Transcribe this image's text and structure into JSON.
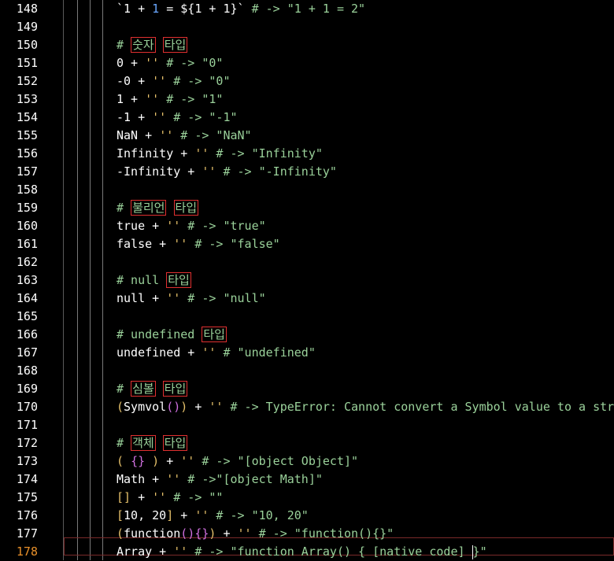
{
  "editor": {
    "line_numbers": [
      "148",
      "149",
      "150",
      "151",
      "152",
      "153",
      "154",
      "155",
      "156",
      "157",
      "158",
      "159",
      "160",
      "161",
      "162",
      "163",
      "164",
      "165",
      "166",
      "167",
      "168",
      "169",
      "170",
      "171",
      "172",
      "173",
      "174",
      "175",
      "176",
      "177",
      "178"
    ],
    "current_line": "178",
    "code_lines": [
      [
        {
          "t": "`1 + ",
          "c": "op"
        },
        {
          "t": "1",
          "c": "num"
        },
        {
          "t": " = ",
          "c": "op"
        },
        {
          "t": "${1 + 1}`",
          "c": "op"
        },
        {
          "t": " # -> \"1 + 1 = 2\"",
          "c": "comment"
        }
      ],
      [],
      [
        {
          "t": "# ",
          "c": "comment"
        },
        {
          "t": "숫자",
          "c": "ko"
        },
        {
          "t": " ",
          "c": "comment"
        },
        {
          "t": "타입",
          "c": "ko"
        }
      ],
      [
        {
          "t": "0 + ",
          "c": "op"
        },
        {
          "t": "''",
          "c": "quote"
        },
        {
          "t": " # -> \"0\"",
          "c": "comment"
        }
      ],
      [
        {
          "t": "-0 + ",
          "c": "op"
        },
        {
          "t": "''",
          "c": "quote"
        },
        {
          "t": " # -> \"0\"",
          "c": "comment"
        }
      ],
      [
        {
          "t": "1 + ",
          "c": "op"
        },
        {
          "t": "''",
          "c": "quote"
        },
        {
          "t": " # -> \"1\"",
          "c": "comment"
        }
      ],
      [
        {
          "t": "-1 + ",
          "c": "op"
        },
        {
          "t": "''",
          "c": "quote"
        },
        {
          "t": " # -> \"-1\"",
          "c": "comment"
        }
      ],
      [
        {
          "t": "NaN + ",
          "c": "op"
        },
        {
          "t": "''",
          "c": "quote"
        },
        {
          "t": " # -> \"NaN\"",
          "c": "comment"
        }
      ],
      [
        {
          "t": "Infinity + ",
          "c": "op"
        },
        {
          "t": "''",
          "c": "quote"
        },
        {
          "t": " # -> \"Infinity\"",
          "c": "comment"
        }
      ],
      [
        {
          "t": "-Infinity + ",
          "c": "op"
        },
        {
          "t": "''",
          "c": "quote"
        },
        {
          "t": " # -> \"-Infinity\"",
          "c": "comment"
        }
      ],
      [],
      [
        {
          "t": "# ",
          "c": "comment"
        },
        {
          "t": "불리언",
          "c": "ko"
        },
        {
          "t": " ",
          "c": "comment"
        },
        {
          "t": "타입",
          "c": "ko"
        }
      ],
      [
        {
          "t": "true + ",
          "c": "op"
        },
        {
          "t": "''",
          "c": "quote"
        },
        {
          "t": " # -> \"true\"",
          "c": "comment"
        }
      ],
      [
        {
          "t": "false + ",
          "c": "op"
        },
        {
          "t": "''",
          "c": "quote"
        },
        {
          "t": " # -> \"false\"",
          "c": "comment"
        }
      ],
      [],
      [
        {
          "t": "# null ",
          "c": "comment"
        },
        {
          "t": "타입",
          "c": "ko"
        }
      ],
      [
        {
          "t": "null + ",
          "c": "op"
        },
        {
          "t": "''",
          "c": "quote"
        },
        {
          "t": " # -> \"null\"",
          "c": "comment"
        }
      ],
      [],
      [
        {
          "t": "# undefined ",
          "c": "comment"
        },
        {
          "t": "타입",
          "c": "ko"
        }
      ],
      [
        {
          "t": "undefined + ",
          "c": "op"
        },
        {
          "t": "''",
          "c": "quote"
        },
        {
          "t": " # \"undefined\"",
          "c": "comment"
        }
      ],
      [],
      [
        {
          "t": "# ",
          "c": "comment"
        },
        {
          "t": "심볼",
          "c": "ko"
        },
        {
          "t": " ",
          "c": "comment"
        },
        {
          "t": "타입",
          "c": "ko"
        }
      ],
      [
        {
          "t": "(",
          "c": "bracket1"
        },
        {
          "t": "Symvol",
          "c": "op"
        },
        {
          "t": "(",
          "c": "bracket2"
        },
        {
          "t": ")",
          "c": "bracket2"
        },
        {
          "t": ")",
          "c": "bracket1"
        },
        {
          "t": " + ",
          "c": "op"
        },
        {
          "t": "''",
          "c": "quote"
        },
        {
          "t": " # -> TypeError: Cannot convert a Symbol value to a string",
          "c": "comment"
        }
      ],
      [],
      [
        {
          "t": "# ",
          "c": "comment"
        },
        {
          "t": "객체",
          "c": "ko"
        },
        {
          "t": " ",
          "c": "comment"
        },
        {
          "t": "타입",
          "c": "ko"
        }
      ],
      [
        {
          "t": "( ",
          "c": "bracket1"
        },
        {
          "t": "{}",
          "c": "bracket2"
        },
        {
          "t": " )",
          "c": "bracket1"
        },
        {
          "t": " + ",
          "c": "op"
        },
        {
          "t": "''",
          "c": "quote"
        },
        {
          "t": " # -> \"[object Object]\"",
          "c": "comment"
        }
      ],
      [
        {
          "t": "Math + ",
          "c": "op"
        },
        {
          "t": "''",
          "c": "quote"
        },
        {
          "t": " # ->\"[object Math]\"",
          "c": "comment"
        }
      ],
      [
        {
          "t": "[]",
          "c": "bracket1"
        },
        {
          "t": " + ",
          "c": "op"
        },
        {
          "t": "''",
          "c": "quote"
        },
        {
          "t": " # -> \"\"",
          "c": "comment"
        }
      ],
      [
        {
          "t": "[",
          "c": "bracket1"
        },
        {
          "t": "10, 20",
          "c": "op"
        },
        {
          "t": "]",
          "c": "bracket1"
        },
        {
          "t": " + ",
          "c": "op"
        },
        {
          "t": "''",
          "c": "quote"
        },
        {
          "t": " # -> \"10, 20\"",
          "c": "comment"
        }
      ],
      [
        {
          "t": "(",
          "c": "bracket1"
        },
        {
          "t": "function",
          "c": "op"
        },
        {
          "t": "()",
          "c": "bracket2"
        },
        {
          "t": "{}",
          "c": "bracket2"
        },
        {
          "t": ")",
          "c": "bracket1"
        },
        {
          "t": " + ",
          "c": "op"
        },
        {
          "t": "''",
          "c": "quote"
        },
        {
          "t": " # -> \"function(){}\"",
          "c": "comment"
        }
      ],
      [
        {
          "t": "Array + ",
          "c": "op"
        },
        {
          "t": "''",
          "c": "quote"
        },
        {
          "t": " # -> \"function Array() { [native code] ",
          "c": "comment"
        },
        {
          "t": "|",
          "c": "cursor"
        },
        {
          "t": "}\"",
          "c": "comment"
        }
      ]
    ]
  }
}
